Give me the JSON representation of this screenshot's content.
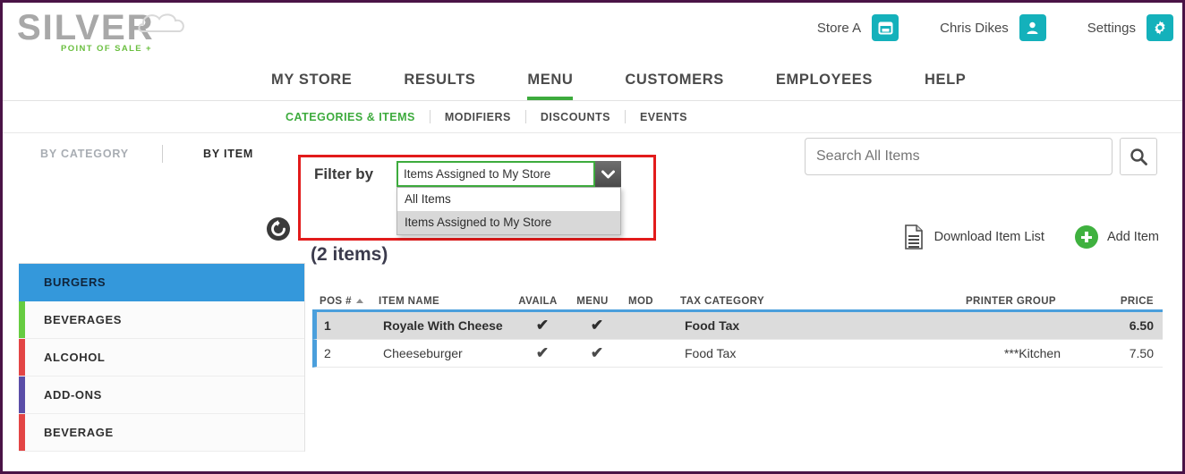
{
  "brand": {
    "name": "SILVER",
    "tagline": "POINT OF SALE +"
  },
  "header": {
    "store_label": "Store A",
    "store_icon": "store-register-icon",
    "user_label": "Chris Dikes",
    "user_icon": "person-icon",
    "settings_label": "Settings",
    "settings_icon": "gear-icon",
    "accent_color": "#14b1bb"
  },
  "main_nav": {
    "items": [
      {
        "label": "MY STORE",
        "active": false
      },
      {
        "label": "RESULTS",
        "active": false
      },
      {
        "label": "MENU",
        "active": true
      },
      {
        "label": "CUSTOMERS",
        "active": false
      },
      {
        "label": "EMPLOYEES",
        "active": false
      },
      {
        "label": "HELP",
        "active": false
      }
    ],
    "active_color": "#3dab3d"
  },
  "sub_nav": {
    "items": [
      {
        "label": "CATEGORIES & ITEMS",
        "active": true
      },
      {
        "label": "MODIFIERS",
        "active": false
      },
      {
        "label": "DISCOUNTS",
        "active": false
      },
      {
        "label": "EVENTS",
        "active": false
      }
    ]
  },
  "toolbar": {
    "by_category_label": "BY CATEGORY",
    "by_item_label": "BY ITEM",
    "refresh_icon": "refresh-icon"
  },
  "search": {
    "placeholder": "Search All Items",
    "value": "",
    "icon": "search-icon"
  },
  "filter": {
    "label": "Filter by",
    "selected": "Items Assigned to My Store",
    "expanded": true,
    "chevron_icon": "chevron-down-icon",
    "options": [
      {
        "label": "All Items",
        "highlighted": false
      },
      {
        "label": "Items Assigned to My Store",
        "highlighted": true
      }
    ],
    "highlight_border_color": "#e21b1b",
    "select_border_color": "#3dab3d"
  },
  "category_header": {
    "title": "BURGERS",
    "count": "(2 items)"
  },
  "actions": {
    "download_label": "Download Item List",
    "download_icon": "document-list-icon",
    "add_label": "Add Item",
    "add_icon": "plus-circle-icon"
  },
  "sidebar": {
    "items": [
      {
        "label": "BURGERS",
        "color": "#3498db",
        "active": true
      },
      {
        "label": "BEVERAGES",
        "color": "#66cc41",
        "active": false
      },
      {
        "label": "ALCOHOL",
        "color": "#e34545",
        "active": false
      },
      {
        "label": "ADD-ONS",
        "color": "#5b4ea8",
        "active": false
      },
      {
        "label": "BEVERAGE",
        "color": "#e34545",
        "active": false
      }
    ]
  },
  "table": {
    "columns": [
      {
        "label": "POS #",
        "sorted": true
      },
      {
        "label": "ITEM NAME",
        "sorted": false
      },
      {
        "label": "AVAILA",
        "sorted": false
      },
      {
        "label": "MENU",
        "sorted": false
      },
      {
        "label": "MOD",
        "sorted": false
      },
      {
        "label": "TAX CATEGORY",
        "sorted": false
      },
      {
        "label": "PRINTER GROUP",
        "sorted": false
      },
      {
        "label": "PRICE",
        "sorted": false
      }
    ],
    "rows": [
      {
        "pos": "1",
        "name": "Royale With Cheese",
        "available": "✔",
        "menu": "✔",
        "mod": "",
        "tax_category": "Food Tax",
        "printer_group": "",
        "price": "6.50",
        "hovered": true
      },
      {
        "pos": "2",
        "name": "Cheeseburger",
        "available": "✔",
        "menu": "✔",
        "mod": "",
        "tax_category": "Food Tax",
        "printer_group": "***Kitchen",
        "price": "7.50",
        "hovered": false
      }
    ]
  }
}
